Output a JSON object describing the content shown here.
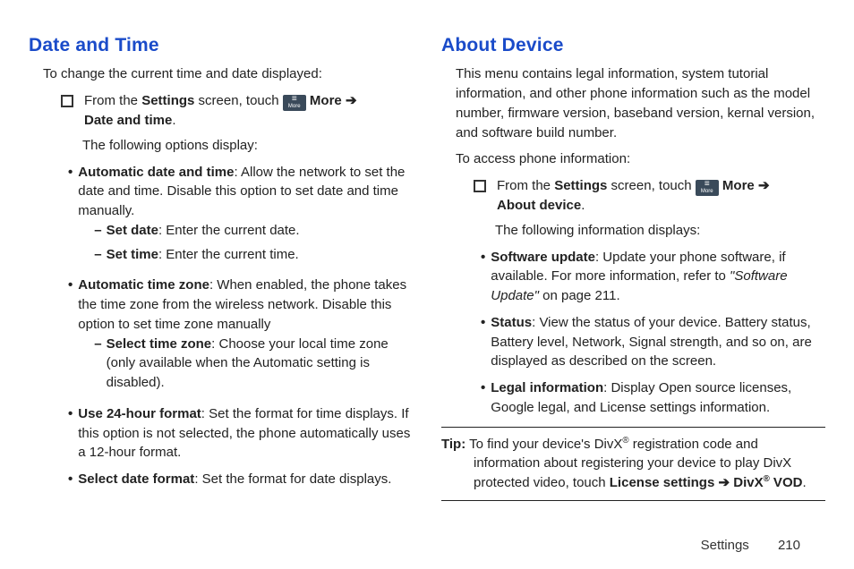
{
  "left": {
    "heading": "Date and Time",
    "intro": "To change the current time and date displayed:",
    "procedure": {
      "prefix": "From the ",
      "settings": "Settings",
      "afterSettings": " screen, touch ",
      "moreIconLabel": "More",
      "more": " More ",
      "arrow": "➔",
      "pathTail": "Date and time",
      "period": "."
    },
    "subintro": "The following options display:",
    "items": [
      {
        "bold": "Automatic date and time",
        "text": ": Allow the network to set the date and time. Disable this option to set date and time manually.",
        "sub": [
          {
            "bold": "Set date",
            "text": ": Enter the current date."
          },
          {
            "bold": "Set time",
            "text": ": Enter the current time."
          }
        ]
      },
      {
        "bold": "Automatic time zone",
        "text": ": When enabled, the phone takes the time zone from the wireless network. Disable this option to set time zone manually",
        "sub": [
          {
            "bold": "Select time zone",
            "text": ": Choose your local time zone (only available when the Automatic setting is disabled)."
          }
        ]
      },
      {
        "bold": "Use 24-hour format",
        "text": ": Set the format for time displays. If this option is not selected, the phone automatically uses a 12-hour format."
      },
      {
        "bold": "Select date format",
        "text": ": Set the format for date displays."
      }
    ]
  },
  "right": {
    "heading": "About Device",
    "intro": "This menu contains legal information, system tutorial information, and other phone information such as the model number, firmware version, baseband version, kernal version, and software build number.",
    "access": "To access phone information:",
    "procedure": {
      "prefix": "From the ",
      "settings": "Settings",
      "afterSettings": " screen, touch ",
      "moreIconLabel": "More",
      "more": " More ",
      "arrow": "➔",
      "pathTail": "About device",
      "period": "."
    },
    "subintro": "The following information displays:",
    "items": [
      {
        "bold": "Software update",
        "text": ": Update your phone software, if available. For more information, refer to ",
        "italic": "\"Software Update\"",
        "tail": "  on page 211."
      },
      {
        "bold": "Status",
        "text": ": View the status of your device. Battery status, Battery level, Network, Signal strength, and so on, are displayed as described on the screen."
      },
      {
        "bold": "Legal information",
        "text": ": Display Open source licenses, Google legal, and License settings information."
      }
    ],
    "tip": {
      "label": "Tip:",
      "pre": " To find your device's DivX",
      "reg": "®",
      "mid": " registration code and information about registering your device to play DivX protected video, touch ",
      "bold1": "License settings ",
      "arrow": "➔",
      "bold2": " DivX",
      "bold2reg": "®",
      "bold3": " VOD",
      "period": "."
    }
  },
  "footer": {
    "section": "Settings",
    "page": "210"
  }
}
